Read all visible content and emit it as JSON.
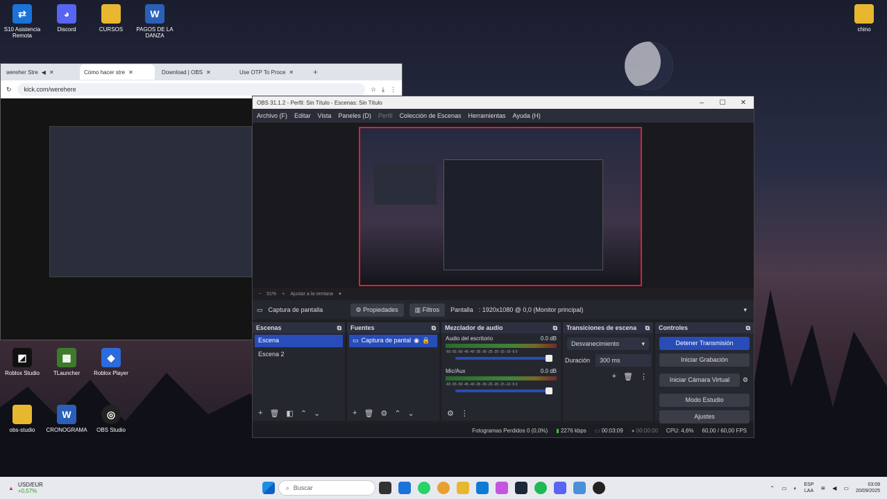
{
  "desktop": {
    "icons": [
      {
        "label": "S10 Asistencia Remota",
        "glyph": "⇄",
        "color": "#1a73d9"
      },
      {
        "label": "Discord",
        "glyph": "◕",
        "color": "#5865f2"
      },
      {
        "label": "CURSOS",
        "glyph": "",
        "color": "#e8b730"
      },
      {
        "label": "PAGOS DE LA DANZA",
        "glyph": "W",
        "color": "#2b5fb8"
      },
      {
        "label": "chino",
        "glyph": "",
        "color": "#e8b730"
      },
      {
        "label": "Roblox Studio",
        "glyph": "◩",
        "color": "#111"
      },
      {
        "label": "TLauncher",
        "glyph": "▦",
        "color": "#3d7a2d"
      },
      {
        "label": "Roblox Player",
        "glyph": "◆",
        "color": "#2b6bdc"
      },
      {
        "label": "obs-studio",
        "glyph": "",
        "color": "#e8b730"
      },
      {
        "label": "CRONOGRAMA",
        "glyph": "W",
        "color": "#2b5fb8"
      },
      {
        "label": "OBS Studio",
        "glyph": "◎",
        "color": "#222"
      }
    ]
  },
  "browser": {
    "tabs": [
      "wereher Stre",
      "Cómo hacer stre",
      "Download | OBS",
      "Use OTP To Proce"
    ],
    "url": "kick.com/werehere"
  },
  "obs": {
    "title": "OBS 31.1.2 - Perfil: Sin Título - Escenas: Sin Título",
    "menu": [
      "Archivo (F)",
      "Editar",
      "Vista",
      "Paneles (D)",
      "Perfil",
      "Colección de Escenas",
      "Herramientas",
      "Ayuda (H)"
    ],
    "zoom": "51%",
    "fit_label": "Ajustar a la ventana",
    "source_name": "Captura de pantalla",
    "properties_label": "Propiedades",
    "filters_label": "Filtros",
    "screen_label": "Pantalla",
    "screen_value": ": 1920x1080 @ 0,0 (Monitor principal)",
    "docks": {
      "scenes": {
        "title": "Escenas",
        "items": [
          "Escena",
          "Escena 2"
        ]
      },
      "sources": {
        "title": "Fuentes",
        "items": [
          "Captura de pantal"
        ]
      },
      "mixer": {
        "title": "Mezclador de audio",
        "channels": [
          {
            "name": "Audio del escritorio",
            "db": "0.0 dB"
          },
          {
            "name": "Mic/Aux",
            "db": "0.0 dB"
          }
        ],
        "scale": "-60 -55 -50 -45 -40 -35 -30 -25 -20 -15 -10 -5 0"
      },
      "transitions": {
        "title": "Transiciones de escena",
        "type": "Desvanecimiento",
        "duration_label": "Duración",
        "duration_value": "300 ms"
      },
      "controls": {
        "title": "Controles",
        "buttons": [
          "Detener Transmisión",
          "Iniciar Grabación",
          "Iniciar Cámara Virtual",
          "Modo Estudio",
          "Ajustes"
        ]
      }
    },
    "status": {
      "dropped": "Fotogramas Perdidos 0 (0,0%)",
      "bitrate": "2276 kbps",
      "stream_time": "00:03:09",
      "rec_time": "00:00:00",
      "cpu": "CPU: 4,6%",
      "fps": "60,00 / 60,00 FPS"
    }
  },
  "taskbar": {
    "ticker": "USD/EUR",
    "ticker_change": "+0,57%",
    "search_placeholder": "Buscar",
    "lang": "ESP",
    "lang_sub": "LAA",
    "time": "03:09",
    "date": "20/09/2025"
  }
}
